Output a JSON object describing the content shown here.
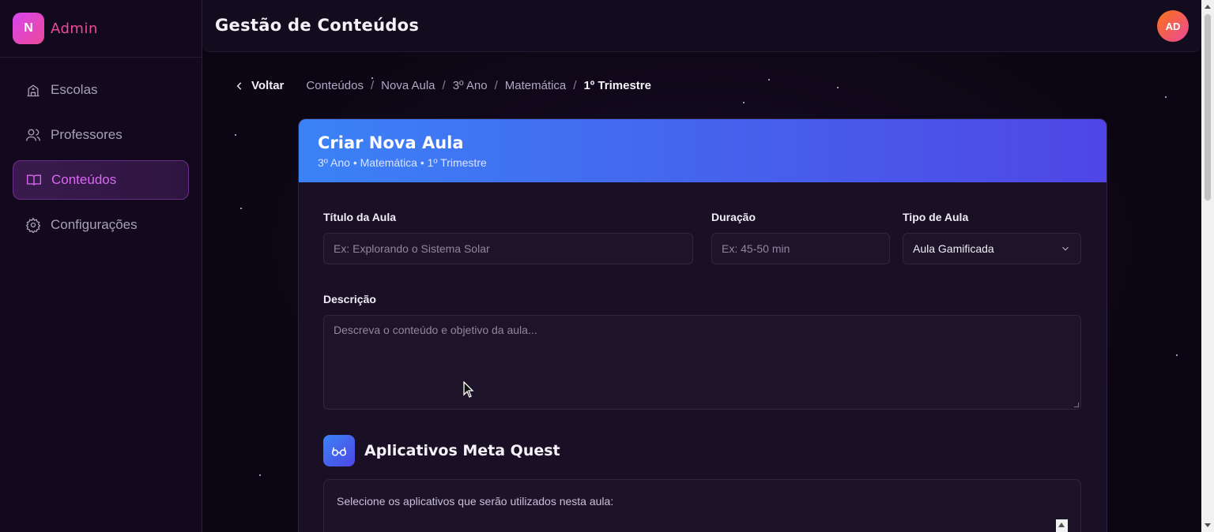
{
  "brand": {
    "logo_letter": "N",
    "name": "Admin"
  },
  "sidebar": {
    "items": [
      {
        "label": "Escolas",
        "icon": "school-icon",
        "active": false
      },
      {
        "label": "Professores",
        "icon": "users-icon",
        "active": false
      },
      {
        "label": "Conteúdos",
        "icon": "book-open-icon",
        "active": true
      },
      {
        "label": "Configurações",
        "icon": "gear-icon",
        "active": false
      }
    ]
  },
  "header": {
    "title": "Gestão de Conteúdos",
    "avatar_initials": "AD"
  },
  "breadcrumb": {
    "back_label": "Voltar",
    "items": [
      "Conteúdos",
      "Nova Aula",
      "3º Ano",
      "Matemática",
      "1º Trimestre"
    ],
    "separator": "/"
  },
  "card": {
    "title": "Criar Nova Aula",
    "subtitle": "3º Ano • Matemática • 1º Trimestre"
  },
  "form": {
    "title_label": "Título da Aula",
    "title_placeholder": "Ex: Explorando o Sistema Solar",
    "duration_label": "Duração",
    "duration_placeholder": "Ex: 45-50 min",
    "type_label": "Tipo de Aula",
    "type_value": "Aula Gamificada",
    "description_label": "Descrição",
    "description_placeholder": "Descreva o conteúdo e objetivo da aula..."
  },
  "apps_section": {
    "icon": "vr-glasses-icon",
    "title": "Aplicativos Meta Quest",
    "hint": "Selecione os aplicativos que serão utilizados nesta aula:"
  },
  "colors": {
    "accent_pink": "#ec4899",
    "accent_purple": "#d946ef",
    "header_gradient_start": "#3b82f6",
    "header_gradient_end": "#4f46e5"
  }
}
